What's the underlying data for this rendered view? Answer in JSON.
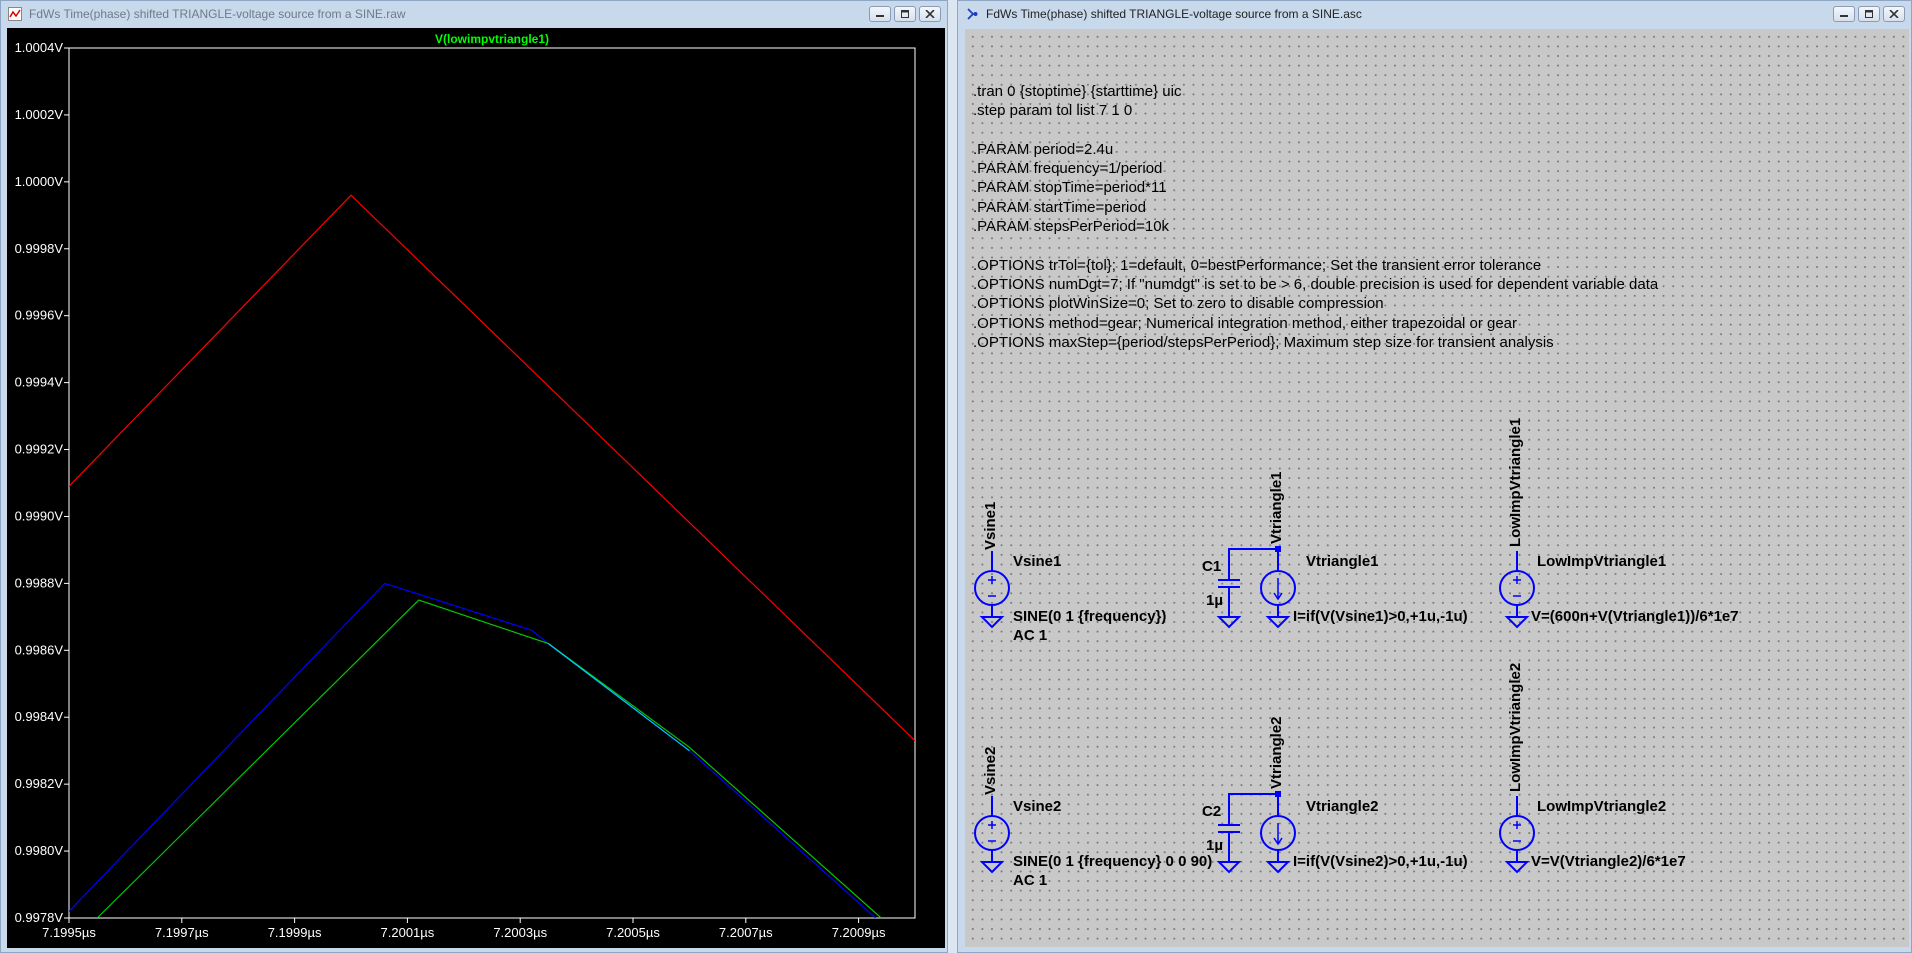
{
  "plot_window": {
    "title": "FdWs Time(phase) shifted TRIANGLE-voltage source from a SINE.raw",
    "trace_label": "V(lowimpvtriangle1)",
    "y_ticks": [
      "1.0004V",
      "1.0002V",
      "1.0000V",
      "0.9998V",
      "0.9996V",
      "0.9994V",
      "0.9992V",
      "0.9990V",
      "0.9988V",
      "0.9986V",
      "0.9984V",
      "0.9982V",
      "0.9980V",
      "0.9978V"
    ],
    "x_ticks": [
      "7.1995µs",
      "7.1997µs",
      "7.1999µs",
      "7.2001µs",
      "7.2003µs",
      "7.2005µs",
      "7.2007µs",
      "7.2009µs"
    ],
    "colors": {
      "background": "#000000",
      "grid_box": "#ffffff",
      "label": "#00ff00",
      "red": "#ff0000",
      "blue": "#0000ff",
      "green": "#00c800",
      "cyan": "#00c8ff"
    }
  },
  "chart_data": {
    "type": "line",
    "title": "V(lowimpvtriangle1)",
    "xlabel": "",
    "ylabel": "",
    "xlim": [
      7.1995,
      7.201
    ],
    "ylim": [
      0.9978,
      1.0004
    ],
    "grid": false,
    "series": [
      {
        "color": "#ff0000",
        "x": [
          7.1995,
          7.2,
          7.201
        ],
        "y": [
          0.99909,
          0.99996,
          0.99833
        ]
      },
      {
        "color": "#0000ff",
        "x": [
          7.1995,
          7.20006,
          7.20032,
          7.20035,
          7.2006,
          7.20093
        ],
        "y": [
          0.99782,
          0.9988,
          0.99866,
          0.99862,
          0.9983,
          0.9978
        ]
      },
      {
        "color": "#00c800",
        "x": [
          7.19955,
          7.20012,
          7.20035,
          7.2006,
          7.20094
        ],
        "y": [
          0.9978,
          0.99875,
          0.99862,
          0.99831,
          0.9978
        ]
      },
      {
        "color": "#00c8ff",
        "x": [
          7.20035,
          7.2006
        ],
        "y": [
          0.99862,
          0.9983
        ]
      }
    ]
  },
  "schematic_window": {
    "title": "FdWs Time(phase) shifted TRIANGLE-voltage source from a SINE.asc",
    "directives": [
      ".tran 0 {stoptime} {starttime} uic",
      ".step param tol list 7 1 0",
      ".PARAM period=2.4u",
      ".PARAM frequency=1/period",
      ".PARAM stopTime=period*11",
      ".PARAM startTime=period",
      ".PARAM stepsPerPeriod=10k",
      ".OPTIONS trTol={tol}; 1=default, 0=bestPerformance; Set the transient error tolerance",
      ".OPTIONS numDgt=7; If \"numdgt\" is set to be > 6, double precision is used for dependent variable data",
      ".OPTIONS plotWinSize=0; Set to zero to disable compression",
      ".OPTIONS method=gear; Numerical integration method, either trapezoidal or gear",
      ".OPTIONS maxStep={period/stepsPerPeriod}; Maximum step size for transient analysis"
    ],
    "components": {
      "vsine1": {
        "net": "Vsine1",
        "name": "Vsine1",
        "value": "SINE(0 1 {frequency})",
        "ac": "AC 1"
      },
      "vsine2": {
        "net": "Vsine2",
        "name": "Vsine2",
        "value": "SINE(0 1 {frequency} 0 0 90)",
        "ac": "AC 1"
      },
      "c1": {
        "name": "C1",
        "value": "1µ"
      },
      "c2": {
        "name": "C2",
        "value": "1µ"
      },
      "vtri1": {
        "net": "Vtriangle1",
        "name": "Vtriangle1",
        "value": "I=if(V(Vsine1)>0,+1u,-1u)"
      },
      "vtri2": {
        "net": "Vtriangle2",
        "name": "Vtriangle2",
        "value": "I=if(V(Vsine2)>0,+1u,-1u)"
      },
      "low1": {
        "net": "LowImpVtriangle1",
        "name": "LowImpVtriangle1",
        "value": "V=(600n+V(Vtriangle1))/6*1e7"
      },
      "low2": {
        "net": "LowImpVtriangle2",
        "name": "LowImpVtriangle2",
        "value": "V=V(Vtriangle2)/6*1e7"
      }
    },
    "colors": {
      "wire": "#0000ff",
      "background": "#c8c8c8"
    }
  }
}
